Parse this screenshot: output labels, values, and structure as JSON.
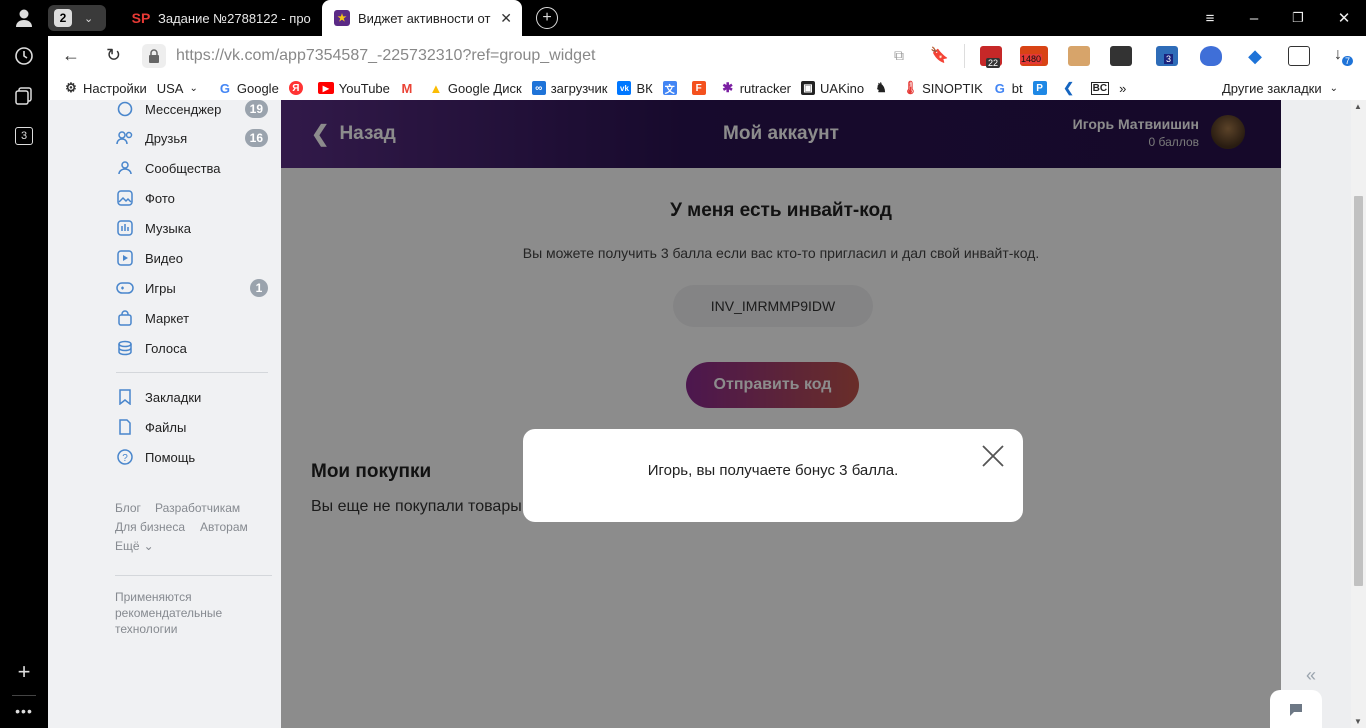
{
  "rail": {
    "tab_count": "2",
    "sidebar_badge": "3"
  },
  "tabs": [
    {
      "label": "Задание №2788122 - про",
      "favicon": "SP"
    },
    {
      "label": "Виджет активности от "
    }
  ],
  "address": {
    "url": "https://vk.com/app7354587_-225732310?ref=group_widget"
  },
  "extensions": {
    "badge_22": "22",
    "badge_1480": "1480",
    "badge_3": "3",
    "downloads": "7"
  },
  "bookmarks": [
    "Настройки",
    "USA",
    "Google",
    "",
    "YouTube",
    "",
    "Google Диск",
    "загрузчик",
    "ВК",
    "",
    "",
    "rutracker",
    "UAKino",
    "",
    "SINOPTIK",
    "bt",
    "",
    "",
    "BC",
    "»"
  ],
  "bookmarks_other": "Другие закладки",
  "sidebar": {
    "items": [
      {
        "label": "Мессенджер",
        "badge": "19"
      },
      {
        "label": "Друзья",
        "badge": "16"
      },
      {
        "label": "Сообщества",
        "badge": ""
      },
      {
        "label": "Фото",
        "badge": ""
      },
      {
        "label": "Музыка",
        "badge": ""
      },
      {
        "label": "Видео",
        "badge": ""
      },
      {
        "label": "Игры",
        "badge": "1"
      },
      {
        "label": "Маркет",
        "badge": ""
      },
      {
        "label": "Голоса",
        "badge": ""
      }
    ],
    "items2": [
      {
        "label": "Закладки"
      },
      {
        "label": "Файлы"
      },
      {
        "label": "Помощь"
      }
    ],
    "footer": {
      "blog": "Блог",
      "dev": "Разработчикам",
      "biz": "Для бизнеса",
      "authors": "Авторам",
      "more": "Ещё"
    },
    "recommend": "Применяются рекомендательные технологии"
  },
  "app": {
    "back": "Назад",
    "title": "Мой аккаунт",
    "user_name": "Игорь Матвиишин",
    "user_points": "0 баллов",
    "invite_title": "У меня есть инвайт-код",
    "invite_desc": "Вы можете получить 3 балла если вас кто-то пригласил и дал свой инвайт-код.",
    "invite_code": "INV_IMRMMP9IDW",
    "send_button": "Отправить код",
    "purchases_title": "Мои покупки",
    "purchases_empty": "Вы еще не покупали товары"
  },
  "modal": {
    "message": "Игорь, вы получаете бонус 3 балла."
  },
  "colors": {
    "accent": "#4986cc",
    "header_dark": "#2b1352",
    "button_from": "#8b2a8f",
    "button_to": "#c0544b"
  }
}
